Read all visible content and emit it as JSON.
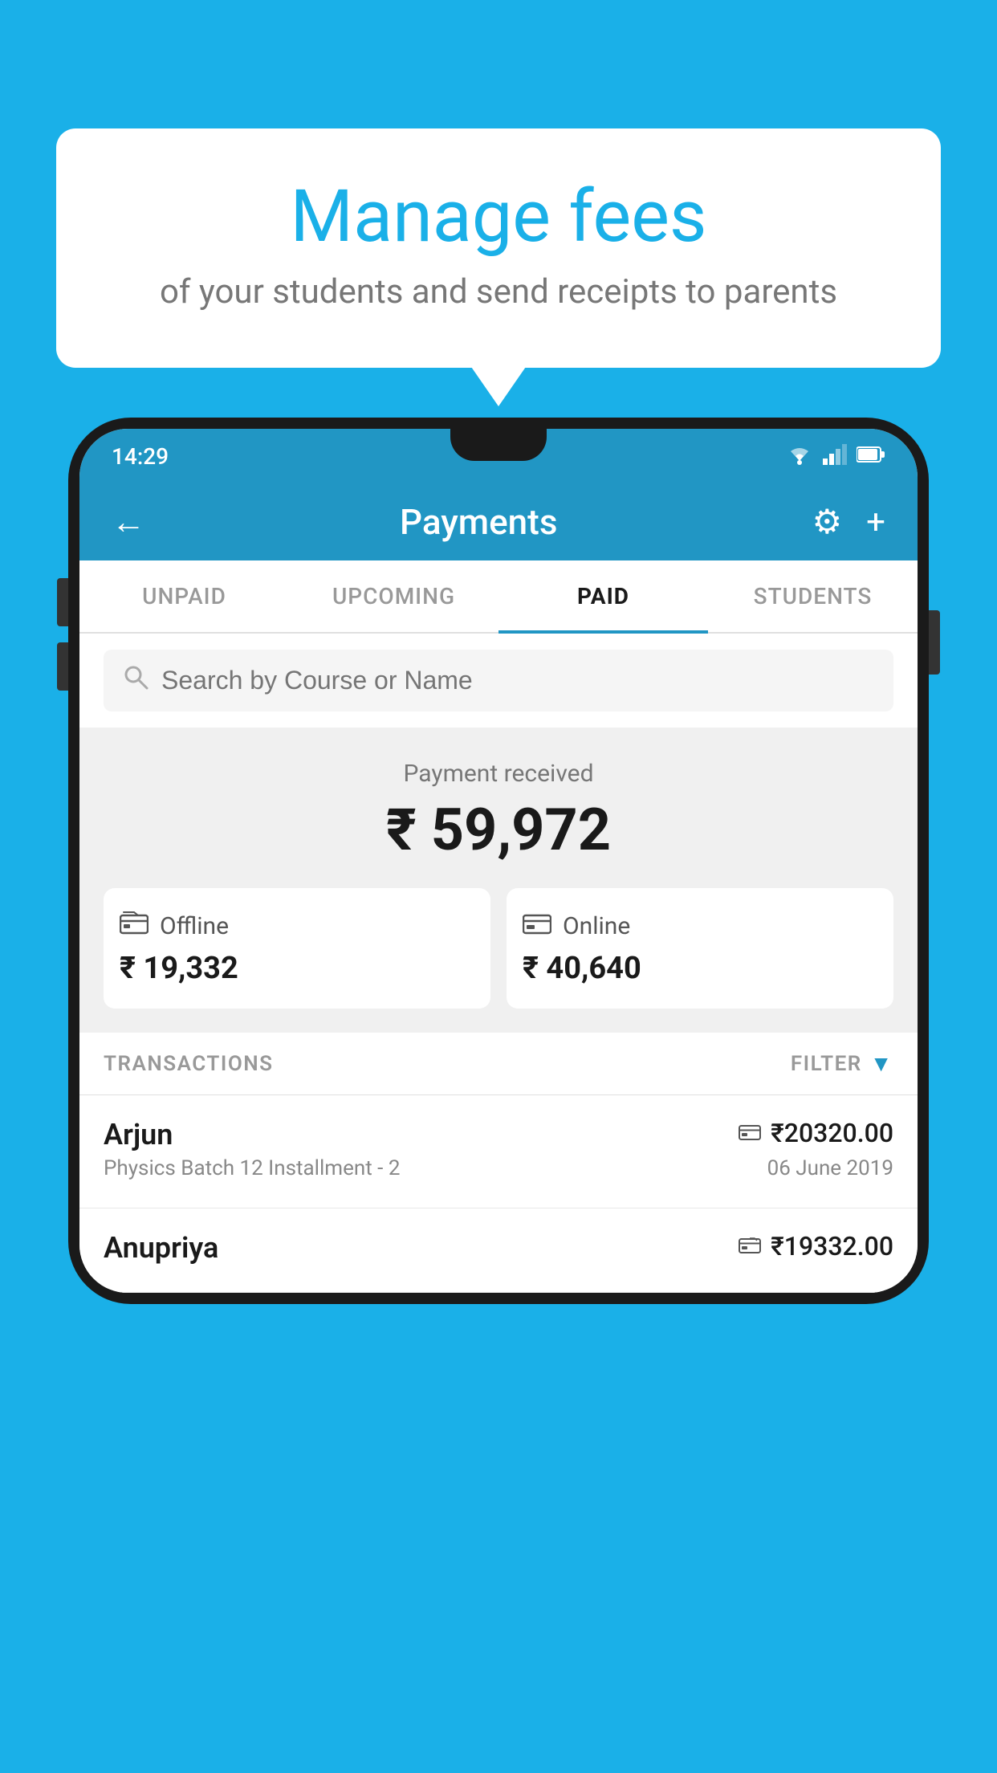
{
  "background_color": "#1ab0e8",
  "speech_bubble": {
    "title": "Manage fees",
    "subtitle": "of your students and send receipts to parents"
  },
  "phone": {
    "status_bar": {
      "time": "14:29"
    },
    "app_header": {
      "title": "Payments",
      "back_label": "←",
      "gear_label": "⚙",
      "plus_label": "+"
    },
    "tabs": [
      {
        "id": "unpaid",
        "label": "UNPAID",
        "active": false
      },
      {
        "id": "upcoming",
        "label": "UPCOMING",
        "active": false
      },
      {
        "id": "paid",
        "label": "PAID",
        "active": true
      },
      {
        "id": "students",
        "label": "STUDENTS",
        "active": false
      }
    ],
    "search": {
      "placeholder": "Search by Course or Name"
    },
    "payment_received": {
      "label": "Payment received",
      "amount": "₹ 59,972",
      "offline": {
        "type": "Offline",
        "amount": "₹ 19,332",
        "icon": "💳"
      },
      "online": {
        "type": "Online",
        "amount": "₹ 40,640",
        "icon": "💳"
      }
    },
    "transactions_header": {
      "label": "TRANSACTIONS",
      "filter_label": "FILTER"
    },
    "transactions": [
      {
        "name": "Arjun",
        "description": "Physics Batch 12 Installment - 2",
        "amount": "₹20320.00",
        "date": "06 June 2019",
        "payment_type": "online"
      },
      {
        "name": "Anupriya",
        "description": "",
        "amount": "₹19332.00",
        "date": "",
        "payment_type": "offline"
      }
    ]
  }
}
